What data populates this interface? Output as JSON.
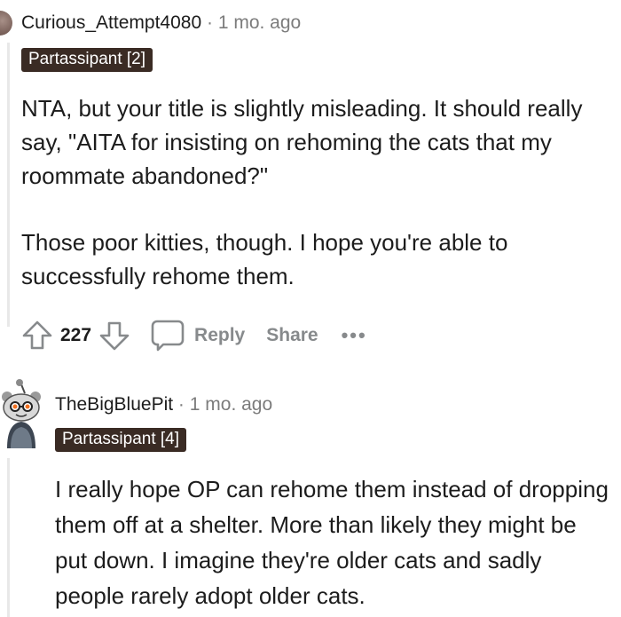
{
  "comment1": {
    "username": "Curious_Attempt4080",
    "separator": "·",
    "time": "1 mo. ago",
    "flair": "Partassipant [2]",
    "paragraph1": "NTA, but your title is slightly misleading. It should really say, \"AITA for insisting on rehoming the cats that my roommate abandoned?\"",
    "paragraph2": "Those poor kitties, though. I hope you're able to successfully rehome them.",
    "actions": {
      "upvote_icon": "arrow-up-icon",
      "vote_count": "227",
      "downvote_icon": "arrow-down-icon",
      "reply_icon": "comment-bubble-icon",
      "reply_label": "Reply",
      "share_label": "Share",
      "more_label": "•••"
    }
  },
  "comment2": {
    "username": "TheBigBluePit",
    "separator": "·",
    "time": "1 mo. ago",
    "flair": "Partassipant [4]",
    "avatar_icon": "snoo-avatar-icon",
    "paragraph": "I really hope OP can rehome them instead of dropping them off at a shelter. More than likely they might be put down. I imagine they're older cats and sadly people rarely adopt older cats."
  },
  "colors": {
    "flair_bg": "#3a2b24",
    "muted": "#878a8c",
    "text": "#1c1c1c",
    "thread_line": "#e8e8e8"
  }
}
